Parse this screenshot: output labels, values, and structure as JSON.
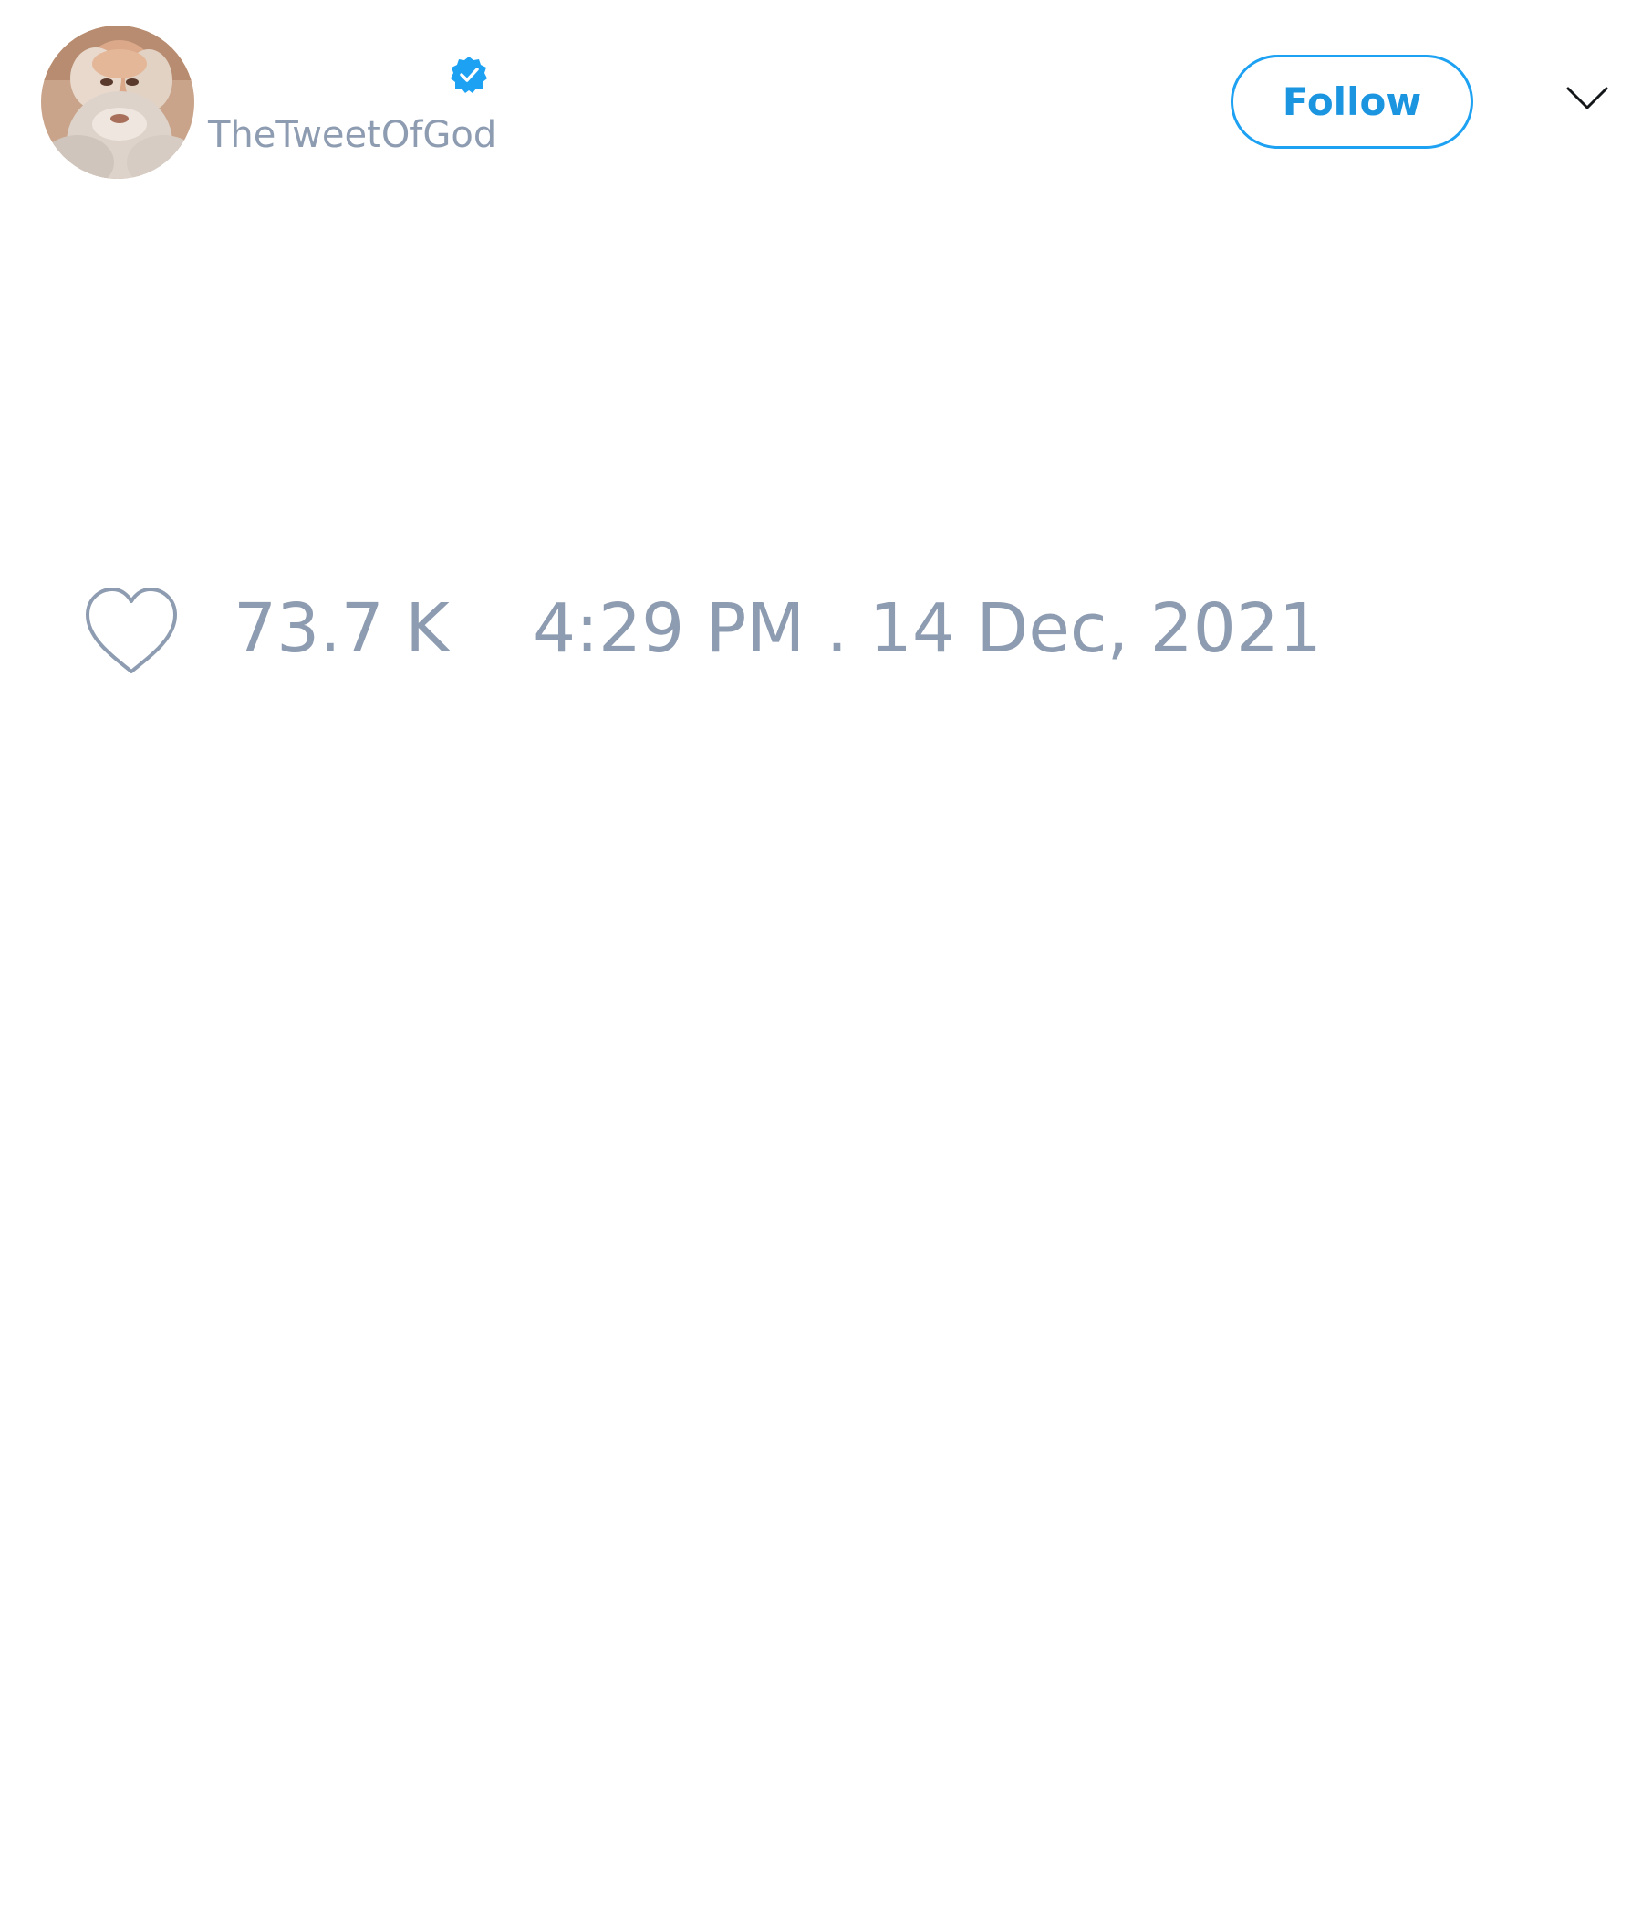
{
  "tweet": {
    "author": {
      "handle": "TheTweetOfGod",
      "verified": true,
      "avatar_alt": "profile photo of a bearded man"
    },
    "follow_label": "Follow",
    "likes": "73.7 K",
    "timestamp": "4:29 PM . 14 Dec, 2021"
  },
  "icons": {
    "verified": "verified-badge-icon",
    "menu": "chevron-down-icon",
    "like": "heart-icon"
  },
  "colors": {
    "accent": "#1da1f2",
    "muted_text": "#8e9cb1",
    "background": "#ffffff"
  }
}
